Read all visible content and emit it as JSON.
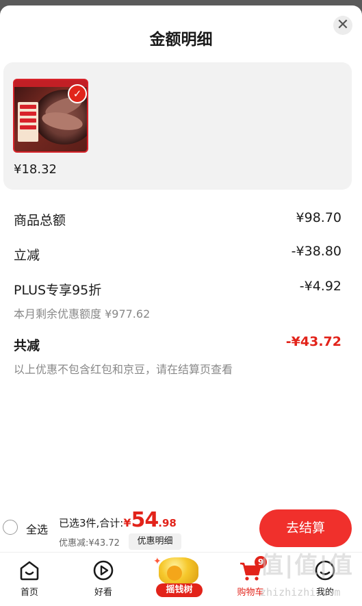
{
  "header": {
    "title": "金额明细",
    "close_symbol": "✕"
  },
  "product": {
    "price": "¥18.32",
    "selected": true
  },
  "breakdown": [
    {
      "label": "商品总额",
      "value": "¥98.70"
    },
    {
      "label": "立减",
      "value": "-¥38.80"
    },
    {
      "label": "PLUS专享95折",
      "value": "-¥4.92",
      "note": "本月剩余优惠额度 ¥977.62"
    }
  ],
  "total": {
    "label": "共减",
    "value": "-¥43.72",
    "note": "以上优惠不包含红包和京豆，请在结算页查看"
  },
  "checkout_bar": {
    "select_all": "全选",
    "summary_prefix": "已选3件,合计:",
    "yen": "¥",
    "amount_int": "54",
    "amount_dec": ".98",
    "discount_text": "优惠减:¥43.72",
    "detail_button": "优惠明细",
    "checkout_button": "去结算"
  },
  "tabs": [
    {
      "label": "首页",
      "icon": "home-icon"
    },
    {
      "label": "好看",
      "icon": "play-icon"
    },
    {
      "label": "摇钱树",
      "icon": "money-tree-icon"
    },
    {
      "label": "购物车",
      "icon": "cart-icon",
      "badge": "9"
    },
    {
      "label": "我的",
      "icon": "profile-icon"
    }
  ],
  "watermark": {
    "glyphs": "值|值|值",
    "url": "zhizhizhi.com"
  },
  "colors": {
    "accent": "#e2231a",
    "checkout": "#f0302c"
  }
}
